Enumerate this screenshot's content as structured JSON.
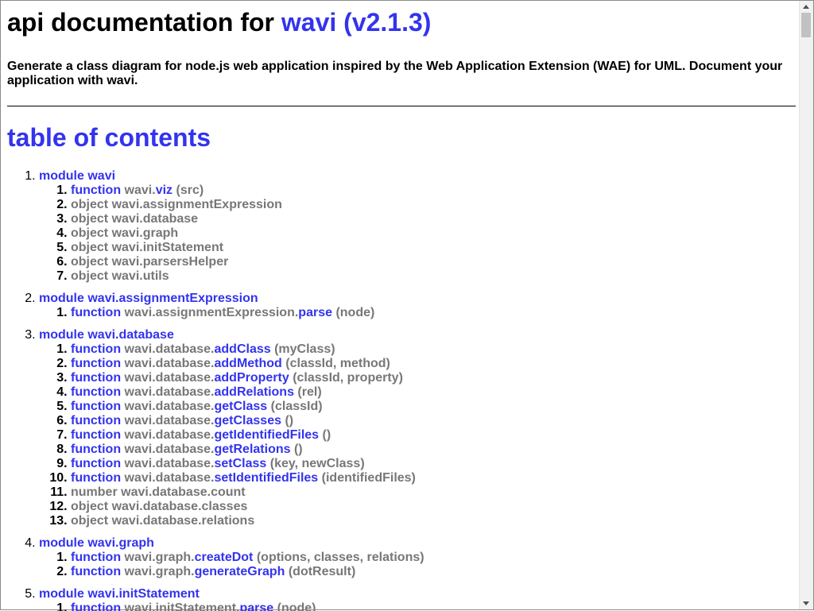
{
  "header": {
    "title_prefix": "api documentation for ",
    "title_link": "wavi (v2.1.3)",
    "description": "Generate a class diagram for node.js web application inspired by the Web Application Extension (WAE) for UML. Document your application with wavi."
  },
  "toc": {
    "heading": "table of contents",
    "modules": [
      {
        "kind": "module",
        "name": "wavi",
        "items": [
          {
            "kind": "function",
            "prefix": "wavi.",
            "name": "viz",
            "args": "(src)"
          },
          {
            "kind": "object",
            "prefix": "",
            "name": "wavi.assignmentExpression",
            "args": ""
          },
          {
            "kind": "object",
            "prefix": "",
            "name": "wavi.database",
            "args": ""
          },
          {
            "kind": "object",
            "prefix": "",
            "name": "wavi.graph",
            "args": ""
          },
          {
            "kind": "object",
            "prefix": "",
            "name": "wavi.initStatement",
            "args": ""
          },
          {
            "kind": "object",
            "prefix": "",
            "name": "wavi.parsersHelper",
            "args": ""
          },
          {
            "kind": "object",
            "prefix": "",
            "name": "wavi.utils",
            "args": ""
          }
        ]
      },
      {
        "kind": "module",
        "name": "wavi.assignmentExpression",
        "items": [
          {
            "kind": "function",
            "prefix": "wavi.assignmentExpression.",
            "name": "parse",
            "args": "(node)"
          }
        ]
      },
      {
        "kind": "module",
        "name": "wavi.database",
        "items": [
          {
            "kind": "function",
            "prefix": "wavi.database.",
            "name": "addClass",
            "args": "(myClass)"
          },
          {
            "kind": "function",
            "prefix": "wavi.database.",
            "name": "addMethod",
            "args": "(classId, method)"
          },
          {
            "kind": "function",
            "prefix": "wavi.database.",
            "name": "addProperty",
            "args": "(classId, property)"
          },
          {
            "kind": "function",
            "prefix": "wavi.database.",
            "name": "addRelations",
            "args": "(rel)"
          },
          {
            "kind": "function",
            "prefix": "wavi.database.",
            "name": "getClass",
            "args": "(classId)"
          },
          {
            "kind": "function",
            "prefix": "wavi.database.",
            "name": "getClasses",
            "args": "()"
          },
          {
            "kind": "function",
            "prefix": "wavi.database.",
            "name": "getIdentifiedFiles",
            "args": "()"
          },
          {
            "kind": "function",
            "prefix": "wavi.database.",
            "name": "getRelations",
            "args": "()"
          },
          {
            "kind": "function",
            "prefix": "wavi.database.",
            "name": "setClass",
            "args": "(key, newClass)"
          },
          {
            "kind": "function",
            "prefix": "wavi.database.",
            "name": "setIdentifiedFiles",
            "args": "(identifiedFiles)"
          },
          {
            "kind": "number",
            "prefix": "",
            "name": "wavi.database.count",
            "args": ""
          },
          {
            "kind": "object",
            "prefix": "",
            "name": "wavi.database.classes",
            "args": ""
          },
          {
            "kind": "object",
            "prefix": "",
            "name": "wavi.database.relations",
            "args": ""
          }
        ]
      },
      {
        "kind": "module",
        "name": "wavi.graph",
        "items": [
          {
            "kind": "function",
            "prefix": "wavi.graph.",
            "name": "createDot",
            "args": "(options, classes, relations)"
          },
          {
            "kind": "function",
            "prefix": "wavi.graph.",
            "name": "generateGraph",
            "args": "(dotResult)"
          }
        ]
      },
      {
        "kind": "module",
        "name": "wavi.initStatement",
        "items": [
          {
            "kind": "function",
            "prefix": "wavi.initStatement.",
            "name": "parse",
            "args": "(node)"
          }
        ]
      }
    ]
  },
  "colors": {
    "link": "#3333ee",
    "muted": "#777777",
    "text": "#000000"
  }
}
